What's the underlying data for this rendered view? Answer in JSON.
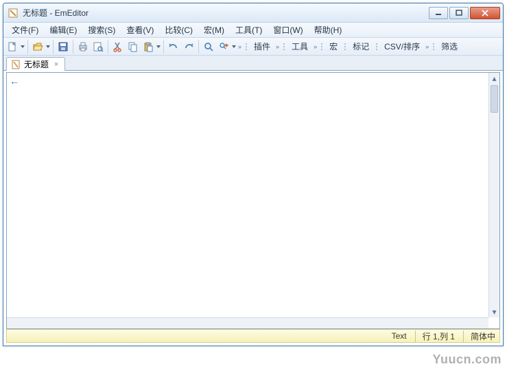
{
  "title": "无标题 - EmEditor",
  "menu": {
    "file": "文件(F)",
    "edit": "编辑(E)",
    "search": "搜索(S)",
    "view": "查看(V)",
    "compare": "比较(C)",
    "macro": "宏(M)",
    "tools": "工具(T)",
    "window": "窗口(W)",
    "help": "帮助(H)"
  },
  "toolbar_groups": {
    "plugins": "插件",
    "tools": "工具",
    "macro": "宏",
    "marks": "标记",
    "csv": "CSV/排序",
    "filter": "筛选"
  },
  "tab": {
    "label": "无标题"
  },
  "status": {
    "mode": "Text",
    "position": "行 1,列 1",
    "encoding": "简体中"
  },
  "watermark": "Yuucn.com"
}
